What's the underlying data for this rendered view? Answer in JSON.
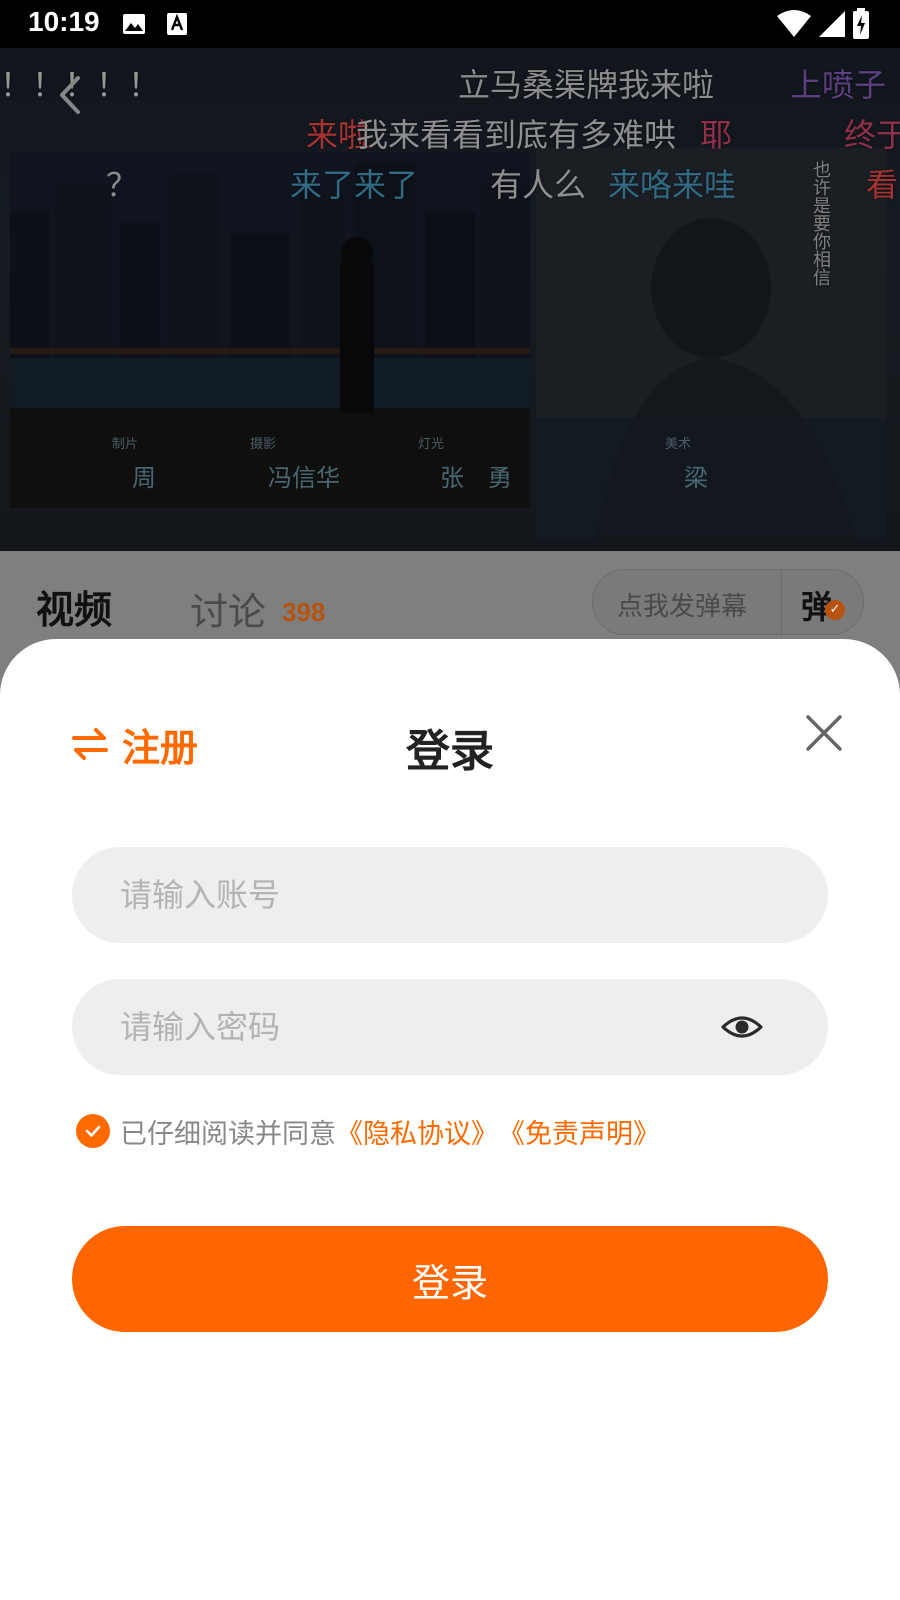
{
  "status_bar": {
    "time": "10:19"
  },
  "video": {
    "danmaku": [
      {
        "text": "！！！！！",
        "color": "#e6e6e6"
      },
      {
        "text": "立马桑渠牌我来啦",
        "color": "#d8d8d8"
      },
      {
        "text": "上喷子",
        "color": "#8e63c6"
      },
      {
        "text": "来啦",
        "color": "#ff4d4d"
      },
      {
        "text": "我来看看到底有多难哄",
        "color": "#dcdcdc"
      },
      {
        "text": "耶",
        "color": "#e04a72"
      },
      {
        "text": "终于",
        "color": "#e04a72"
      },
      {
        "text": "？",
        "color": "#d8d8d8"
      },
      {
        "text": "来了来了",
        "color": "#4aa3c9"
      },
      {
        "text": "有人么",
        "color": "#dcdcdc"
      },
      {
        "text": "来咯来哇",
        "color": "#4aa3c9"
      },
      {
        "text": "看",
        "color": "#ff4d4d"
      }
    ],
    "credits": [
      {
        "role": "制片",
        "name": "周"
      },
      {
        "role": "摄影",
        "name": "冯信华"
      },
      {
        "role": "灯光",
        "name": "张　勇"
      },
      {
        "role": "美术",
        "name": "梁"
      }
    ],
    "poster_text": "也许是要你相信"
  },
  "tabs": {
    "video_label": "视频",
    "discuss_label": "讨论",
    "discuss_count": "398",
    "danmaku_placeholder": "点我发弹幕",
    "danmaku_toggle": "弹"
  },
  "login_sheet": {
    "register_label": "注册",
    "title": "登录",
    "account_placeholder": "请输入账号",
    "password_placeholder": "请输入密码",
    "agree_text": "已仔细阅读并同意",
    "privacy_link": "《隐私协议》",
    "disclaimer_link": "《免责声明》",
    "login_button": "登录"
  },
  "colors": {
    "accent": "#ff6a00",
    "field_bg": "#eeeeee",
    "overlay": "#7f7f7f"
  }
}
